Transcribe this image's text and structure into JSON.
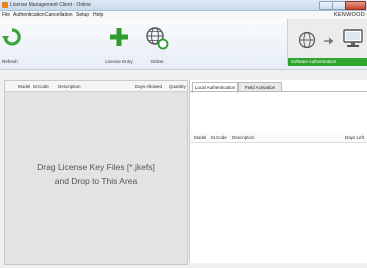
{
  "window": {
    "title": "License Management Client - Online"
  },
  "menu": {
    "items": [
      "File",
      "Authentication",
      "Cancellation",
      "Setup",
      "Help"
    ],
    "brand": "KENWOOD"
  },
  "toolbar": {
    "refresh_label": "Refresh",
    "license_entry_label": "License Entry",
    "online_label": "Online"
  },
  "software_auth": {
    "label": "Software Authentication"
  },
  "left_table": {
    "columns": [
      "Model",
      "M.Code",
      "Description",
      "Days Allowed",
      "Quantity"
    ]
  },
  "drop_hint": {
    "line1": "Drag License Key Files [*.jkefs]",
    "line2": "and Drop to This Area"
  },
  "tabs": [
    "Local Authentication",
    "Field Activation"
  ],
  "right_table": {
    "columns": [
      "Model",
      "M.Code",
      "Description",
      "Days Left"
    ]
  },
  "colors": {
    "refresh_green": "#3aa53a",
    "plus_green": "#2e9d2e",
    "auth_bar_green": "#2fa52f"
  }
}
